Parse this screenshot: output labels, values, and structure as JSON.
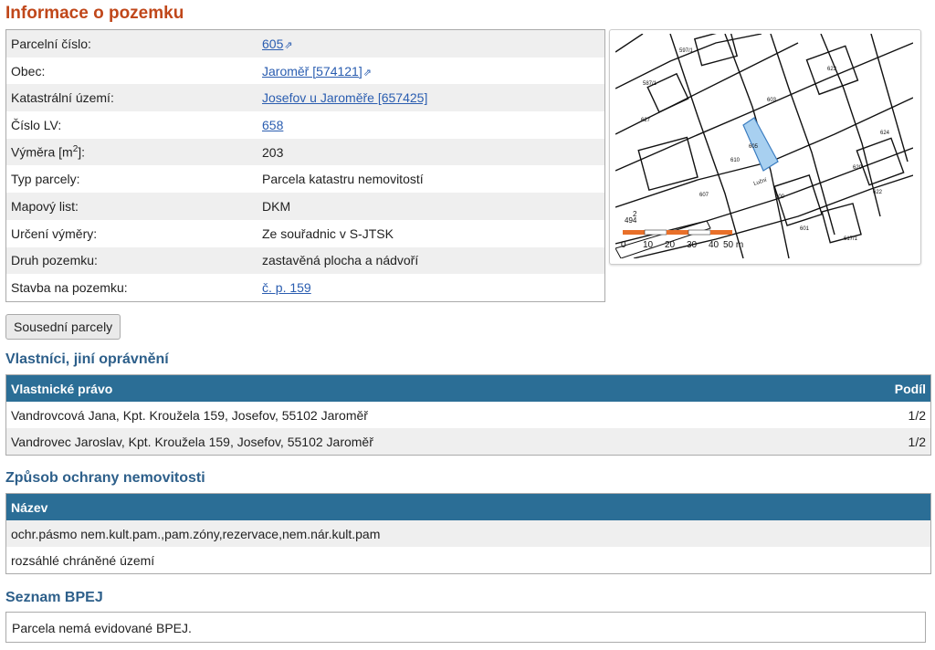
{
  "title": "Informace o pozemku",
  "parcel_info": [
    {
      "label": "Parcelní číslo:",
      "value": "605",
      "link": true,
      "ext": true
    },
    {
      "label": "Obec:",
      "value": "Jaroměř [574121]",
      "link": true,
      "ext": true
    },
    {
      "label": "Katastrální území:",
      "value": "Josefov u Jaroměře [657425]",
      "link": true,
      "ext": false
    },
    {
      "label": "Číslo LV:",
      "value": "658",
      "link": true,
      "ext": false
    },
    {
      "label": "Výměra [m",
      "label_sup": "2",
      "label_tail": "]:",
      "value": "203",
      "link": false,
      "ext": false
    },
    {
      "label": "Typ parcely:",
      "value": "Parcela katastru nemovitostí",
      "link": false,
      "ext": false
    },
    {
      "label": "Mapový list:",
      "value": "DKM",
      "link": false,
      "ext": false
    },
    {
      "label": "Určení výměry:",
      "value": "Ze souřadnic v S-JTSK",
      "link": false,
      "ext": false
    },
    {
      "label": "Druh pozemku:",
      "value": "zastavěná plocha a nádvoří",
      "link": false,
      "ext": false
    },
    {
      "label": "Stavba na pozemku:",
      "value": "č. p. 159",
      "link": true,
      "ext": false
    }
  ],
  "ext_icon": "⇗",
  "map": {
    "scale_labels": [
      "0",
      "10",
      "20",
      "30",
      "40",
      "50 m"
    ],
    "parcel_labels": [
      "605",
      "610",
      "607",
      "603",
      "600",
      "601",
      "620",
      "622",
      "623",
      "624",
      "617/1",
      "627",
      "587/1",
      "597/1",
      "Luční",
      "494",
      "2"
    ],
    "accent_color": "#e8702a",
    "highlight_color": "#a8d0f0"
  },
  "neighbors_button": "Sousední parcely",
  "owners": {
    "heading": "Vlastníci, jiní oprávnění",
    "col_owner": "Vlastnické právo",
    "col_share": "Podíl",
    "rows": [
      {
        "name": "Vandrovcová Jana, Kpt. Kroužela 159, Josefov, 55102 Jaroměř",
        "share": "1/2"
      },
      {
        "name": "Vandrovec Jaroslav, Kpt. Kroužela 159, Josefov, 55102 Jaroměř",
        "share": "1/2"
      }
    ]
  },
  "protection": {
    "heading": "Způsob ochrany nemovitosti",
    "col_name": "Název",
    "rows": [
      "ochr.pásmo nem.kult.pam.,pam.zóny,rezervace,nem.nár.kult.pam",
      "rozsáhlé chráněné území"
    ]
  },
  "bpej": {
    "heading": "Seznam BPEJ",
    "note": "Parcela nemá evidované BPEJ."
  }
}
